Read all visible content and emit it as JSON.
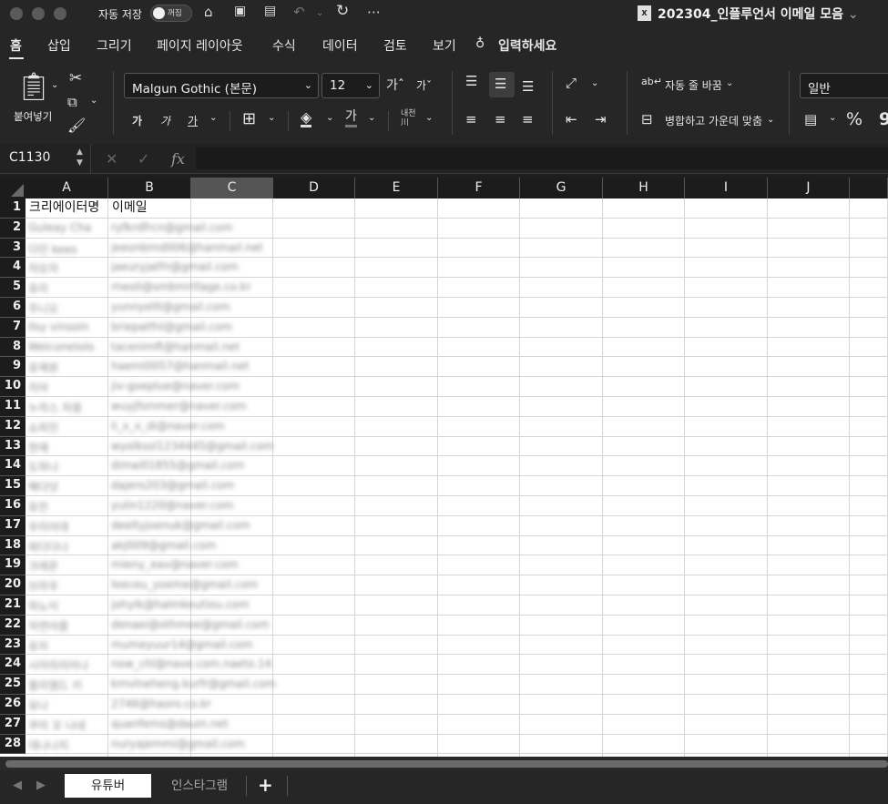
{
  "titlebar": {
    "autosave_label": "자동 저장",
    "autosave_state": "꺼짐",
    "doc_title": "202304_인플루언서 이메일 모음",
    "doc_icon_label": "X",
    "title_chevron": "⌄",
    "quick_access_icons": [
      "home-icon",
      "save-icon",
      "save-as-icon",
      "undo-icon",
      "redo-icon",
      "more-icon"
    ]
  },
  "menu": {
    "items": [
      "홈",
      "삽입",
      "그리기",
      "페이지 레이아웃",
      "수식",
      "데이터",
      "검토",
      "보기"
    ],
    "tell_me": "입력하세요",
    "tell_me_bold_prefix": "입력하세요"
  },
  "ribbon": {
    "paste_label": "붙여넣기",
    "font_name": "Malgun Gothic (본문)",
    "font_size": "12",
    "grow_font": "가ˆ",
    "shrink_font": "가ˇ",
    "bold": "가",
    "italic": "가",
    "underline": "가",
    "phonetic": "내천\n川",
    "wrap_text": "자동 줄 바꿈",
    "merge_center": "병합하고 가운데 맞춤",
    "number_format": "일반",
    "percent": "%",
    "comma": "9"
  },
  "formula_bar": {
    "name_box": "C1130",
    "fx": "fx",
    "cancel": "✕",
    "confirm": "✓",
    "content": ""
  },
  "sheet": {
    "columns": [
      "A",
      "B",
      "C",
      "D",
      "E",
      "F",
      "G",
      "H",
      "I",
      "J"
    ],
    "selected_column": "C",
    "rows": [
      "1",
      "2",
      "3",
      "4",
      "5",
      "6",
      "7",
      "8",
      "9",
      "10",
      "11",
      "12",
      "13",
      "14",
      "15",
      "16",
      "17",
      "18",
      "19",
      "20",
      "21",
      "22",
      "23",
      "24",
      "25",
      "26",
      "27",
      "28"
    ],
    "header_row": {
      "a": "크리에이터명",
      "b": "이메일"
    },
    "blurred_rows": [
      {
        "a": "Guleay Cha",
        "b": "ryfkrdfrcn@gmail.com"
      },
      {
        "a": "다인 kees",
        "b": "jeeonbmd006@hanmail.net"
      },
      {
        "a": "자모자",
        "b": "jaeuryjatfn@gmail.com"
      },
      {
        "a": "유리",
        "b": "rneoli@smbmrillage.co.kr"
      },
      {
        "a": "주니오",
        "b": "yunnyellt@gmail.com"
      },
      {
        "a": "Ilsy vinsoin",
        "b": "briepatfnl@gmail.com"
      },
      {
        "a": "Welconelolo",
        "b": "tacenimft@hanmail.net"
      },
      {
        "a": "유재원",
        "b": "haemi0057@hanmail.net"
      },
      {
        "a": "지아",
        "b": "jiv-goeplue@naver.com"
      },
      {
        "a": "누자스 자몽",
        "b": "wuyjfsmmer@naver.com"
      },
      {
        "a": "쇼피인",
        "b": "li_x_x_di@naver.com"
      },
      {
        "a": "현재",
        "b": "wyolkssl1234445@gmail.com"
      },
      {
        "a": "도하나",
        "b": "dimai01855@gmail.com"
      },
      {
        "a": "해다닷",
        "b": "dajero203@gmail.com"
      },
      {
        "a": "유진",
        "b": "yulin1220@naver.com"
      },
      {
        "a": "우리아데",
        "b": "deeltyjoenuk@gmail.com"
      },
      {
        "a": "파다다나",
        "b": "akj009@gmail.com"
      },
      {
        "a": "크레온",
        "b": "mieny_eav@naver.com"
      },
      {
        "a": "브라우",
        "b": "leeceu_yoeme@gmail.com"
      },
      {
        "a": "하노이",
        "b": "johylk@halmkeutiou.com"
      },
      {
        "a": "자연아름",
        "b": "denaei@othmee@gmail.com"
      },
      {
        "a": "유지",
        "b": "mumeyuur14@gmail.com"
      },
      {
        "a": "시아라리아나",
        "b": "now_chl@nave.com.naeto.14"
      },
      {
        "a": "블리엠드 키",
        "b": "kmvlneheng.kurfr@gmail.com"
      },
      {
        "a": "유나",
        "b": "2746@haoro.co.kr"
      },
      {
        "a": "쿠미 꼬 나네",
        "b": "quanfems@dauin.net"
      },
      {
        "a": "대나나지",
        "b": "nuryajemmi@gmail.com"
      }
    ]
  },
  "tabs": {
    "items": [
      "유튜버",
      "인스타그램"
    ],
    "active": 0,
    "add_label": "+",
    "prev": "◀",
    "next": "▶"
  }
}
